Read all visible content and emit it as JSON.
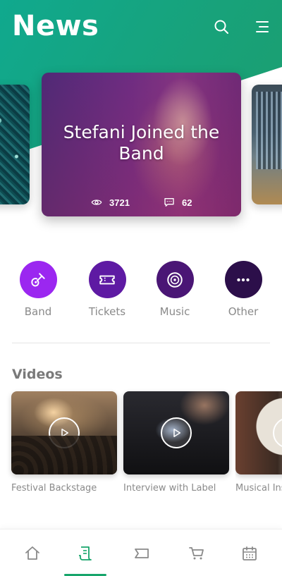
{
  "app": {
    "title": "News",
    "accent_color": "#17a56b",
    "header_color": "#14a58a"
  },
  "header": {
    "search_icon": "search-icon",
    "menu_icon": "menu-icon"
  },
  "featured": {
    "title": "Stefani Joined the Band",
    "views": "3721",
    "comments": "62",
    "views_icon": "eye-icon",
    "comments_icon": "comment-icon"
  },
  "categories": [
    {
      "label": "Band",
      "icon": "guitar-icon",
      "color": "#9b27f0"
    },
    {
      "label": "Tickets",
      "icon": "ticket-icon",
      "color": "#5e1aa3"
    },
    {
      "label": "Music",
      "icon": "disc-icon",
      "color": "#4a1675"
    },
    {
      "label": "Other",
      "icon": "more-icon",
      "color": "#2c0f4a"
    }
  ],
  "videos_section": {
    "title": "Videos",
    "items": [
      {
        "label": "Festival Backstage"
      },
      {
        "label": "Interview with Label"
      },
      {
        "label": "Musical Ins"
      }
    ]
  },
  "bottom_nav": {
    "items": [
      {
        "icon": "home-icon",
        "active": false
      },
      {
        "icon": "news-icon",
        "active": true
      },
      {
        "icon": "ticket-icon",
        "active": false
      },
      {
        "icon": "cart-icon",
        "active": false
      },
      {
        "icon": "calendar-icon",
        "active": false
      }
    ]
  }
}
